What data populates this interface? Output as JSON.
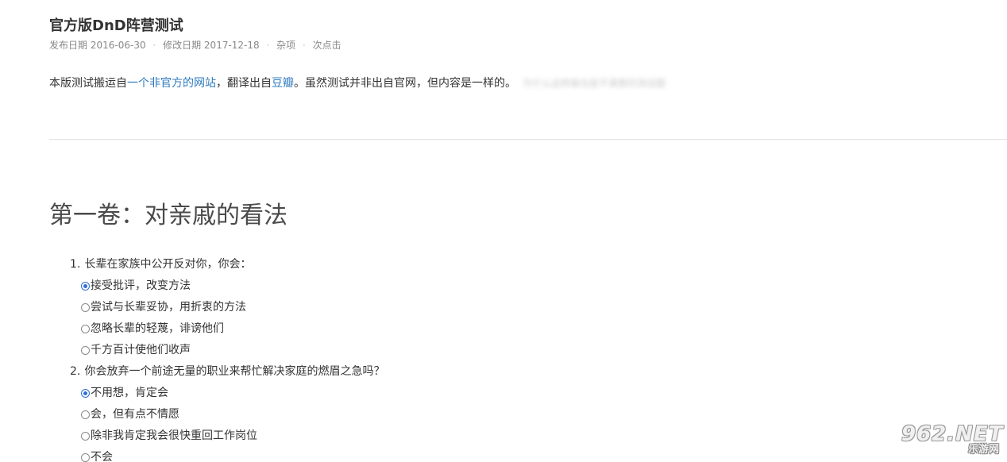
{
  "post": {
    "title": "官方版DnD阵营测试",
    "meta": {
      "published_label": "发布日期",
      "published_date": "2016-06-30",
      "modified_label": "修改日期",
      "modified_date": "2017-12-18",
      "category": "杂项",
      "views": "次点击"
    },
    "intro": {
      "prefix": "本版测试搬运自",
      "link1": "一个非官方的网站",
      "middle": "，翻译出自",
      "link2": "豆瓣",
      "suffix": "。虽然测试并非出自官网，但内容是一样的。",
      "blurred_text": "为什么这样做也是不满意的测试题"
    }
  },
  "section": {
    "heading": "第一卷：对亲戚的看法"
  },
  "questions": [
    {
      "number": "1.",
      "text": "长辈在家族中公开反对你，你会：",
      "options": [
        {
          "label": "接受批评，改变方法",
          "checked": true
        },
        {
          "label": "尝试与长辈妥协，用折衷的方法",
          "checked": false
        },
        {
          "label": "忽略长辈的轻蔑，诽谤他们",
          "checked": false
        },
        {
          "label": "千方百计使他们收声",
          "checked": false
        }
      ]
    },
    {
      "number": "2.",
      "text": "你会放弃一个前途无量的职业来帮忙解决家庭的燃眉之急吗？",
      "options": [
        {
          "label": "不用想，肯定会",
          "checked": true
        },
        {
          "label": "会，但有点不情愿",
          "checked": false
        },
        {
          "label": "除非我肯定我会很快重回工作岗位",
          "checked": false
        },
        {
          "label": "不会",
          "checked": false
        }
      ]
    }
  ],
  "watermark": {
    "logo": "962.NET",
    "sub": "乐游网"
  },
  "colors": {
    "link": "#2f7bbf",
    "radio_checked": "#2e6fd8",
    "heading": "#4a4a4a"
  }
}
